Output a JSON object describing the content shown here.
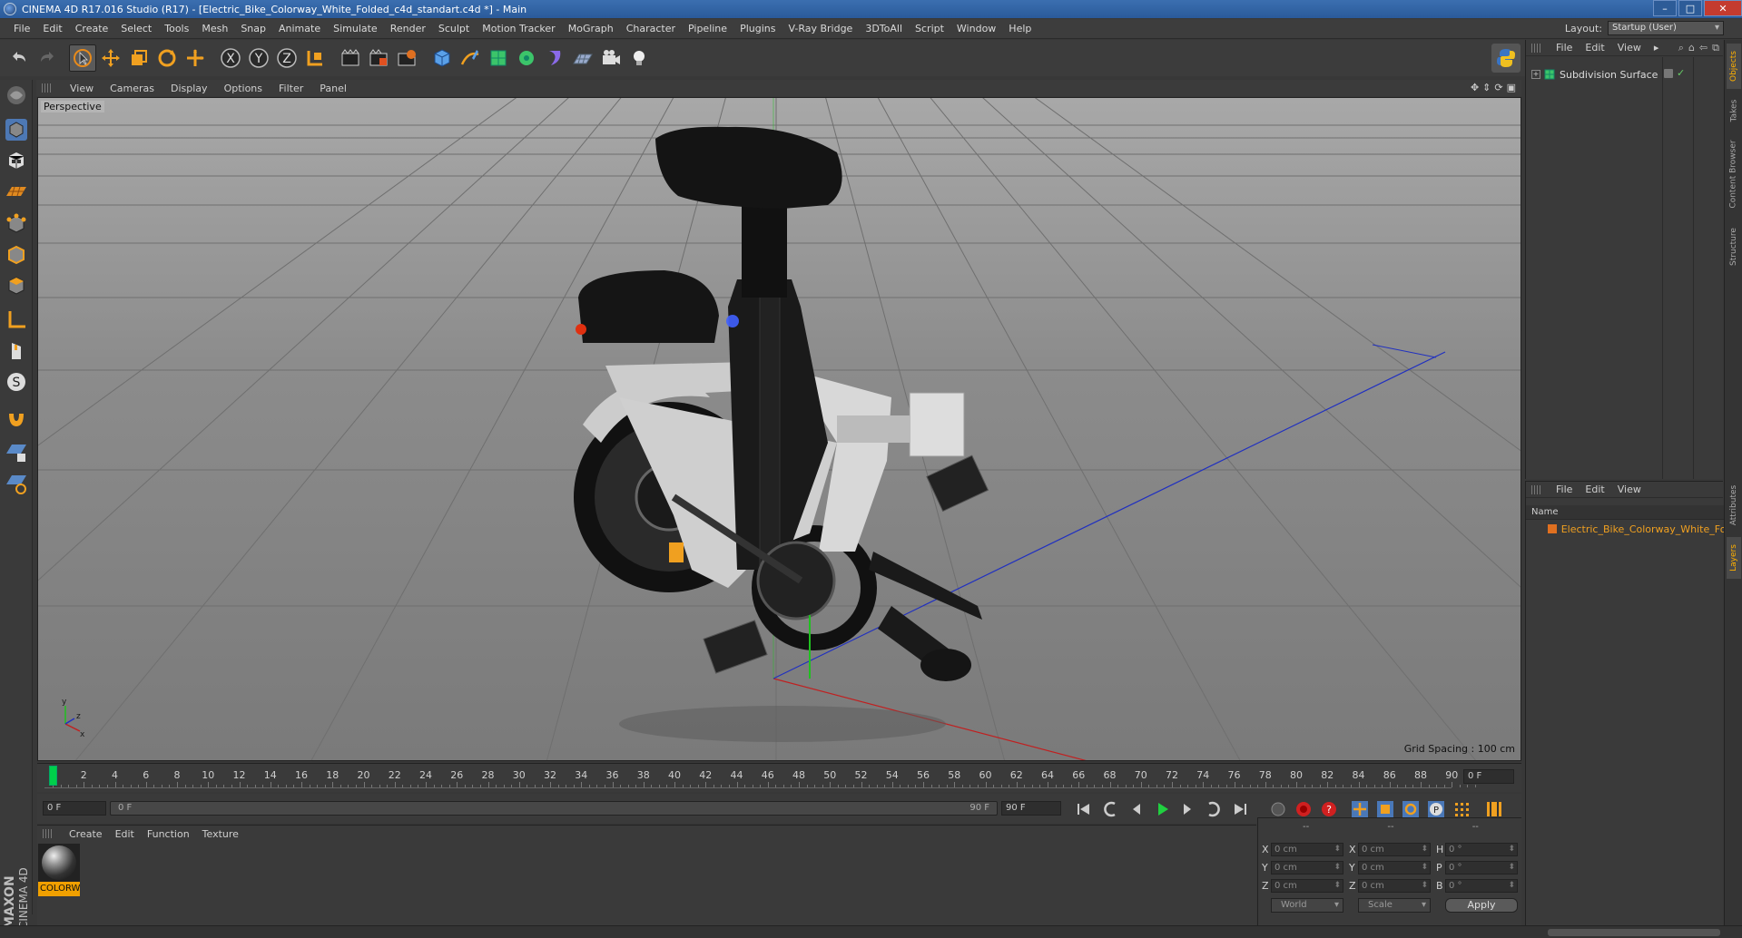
{
  "window": {
    "title": "CINEMA 4D R17.016 Studio (R17) - [Electric_Bike_Colorway_White_Folded_c4d_standart.c4d *] - Main",
    "controls": {
      "minimize": "–",
      "maximize": "□",
      "close": "✕"
    }
  },
  "menubar": {
    "items": [
      "File",
      "Edit",
      "Create",
      "Select",
      "Tools",
      "Mesh",
      "Snap",
      "Animate",
      "Simulate",
      "Render",
      "Sculpt",
      "Motion Tracker",
      "MoGraph",
      "Character",
      "Pipeline",
      "Plugins",
      "V-Ray Bridge",
      "3DToAll",
      "Script",
      "Window",
      "Help"
    ],
    "layout_label": "Layout:",
    "layout_value": "Startup (User)"
  },
  "toolbar": {
    "icons": [
      "undo-icon",
      "redo-icon",
      "select-icon",
      "move-icon",
      "scale-icon",
      "rotate-icon",
      "live-select-icon",
      "x-axis-icon",
      "y-axis-icon",
      "z-axis-icon",
      "coordinate-system-icon",
      "render-view-icon",
      "render-picture-viewer-icon",
      "edit-render-settings-icon",
      "cube-icon",
      "pen-icon",
      "subdivision-icon",
      "array-icon",
      "deformer-icon",
      "floor-icon",
      "camera-icon",
      "light-icon"
    ],
    "axis_labels": [
      "X",
      "Y",
      "Z"
    ]
  },
  "viewport": {
    "menu": [
      "View",
      "Cameras",
      "Display",
      "Options",
      "Filter",
      "Panel"
    ],
    "label": "Perspective",
    "grid_spacing": "Grid Spacing : 100 cm",
    "colors": {
      "bg_top": "#a8a8a8",
      "bg_bottom": "#7a7a7a",
      "grid": "#6f6f6f",
      "axis_x": "#c02020",
      "axis_y": "#20c020",
      "axis_z": "#2030c0"
    }
  },
  "timeline": {
    "ticks": [
      "0",
      "2",
      "4",
      "6",
      "8",
      "10",
      "12",
      "14",
      "16",
      "18",
      "20",
      "22",
      "24",
      "26",
      "28",
      "30",
      "32",
      "34",
      "36",
      "38",
      "40",
      "42",
      "44",
      "46",
      "48",
      "50",
      "52",
      "54",
      "56",
      "58",
      "60",
      "62",
      "64",
      "66",
      "68",
      "70",
      "72",
      "74",
      "76",
      "78",
      "80",
      "82",
      "84",
      "86",
      "88",
      "90"
    ],
    "current_frame": "0 F"
  },
  "transport": {
    "start_field": "0 F",
    "range_start": "0 F",
    "range_end": "90 F",
    "end_field": "90 F"
  },
  "material_manager": {
    "menu": [
      "Create",
      "Edit",
      "Function",
      "Texture"
    ],
    "material_name": "COLORW"
  },
  "coordinates": {
    "headers": [
      "--",
      "--",
      "--"
    ],
    "rows": [
      {
        "l1": "X",
        "v1": "0 cm",
        "l2": "X",
        "v2": "0 cm",
        "l3": "H",
        "v3": "0 °"
      },
      {
        "l1": "Y",
        "v1": "0 cm",
        "l2": "Y",
        "v2": "0 cm",
        "l3": "P",
        "v3": "0 °"
      },
      {
        "l1": "Z",
        "v1": "0 cm",
        "l2": "Z",
        "v2": "0 cm",
        "l3": "B",
        "v3": "0 °"
      }
    ],
    "mode_world": "World",
    "mode_scale": "Scale",
    "apply": "Apply"
  },
  "object_manager": {
    "menu": [
      "File",
      "Edit",
      "View"
    ],
    "objects": [
      {
        "name": "Subdivision Surface"
      }
    ]
  },
  "layer_manager": {
    "menu": [
      "File",
      "Edit",
      "View"
    ],
    "column_name": "Name",
    "layers": [
      {
        "name": "Electric_Bike_Colorway_White_Fol",
        "color": "#e07020"
      }
    ]
  },
  "right_tabs": [
    "Objects",
    "Takes",
    "Content Browser",
    "Structure",
    "Attributes",
    "Layers"
  ],
  "branding": {
    "maxon": "MAXON",
    "c4d": "CINEMA 4D"
  }
}
